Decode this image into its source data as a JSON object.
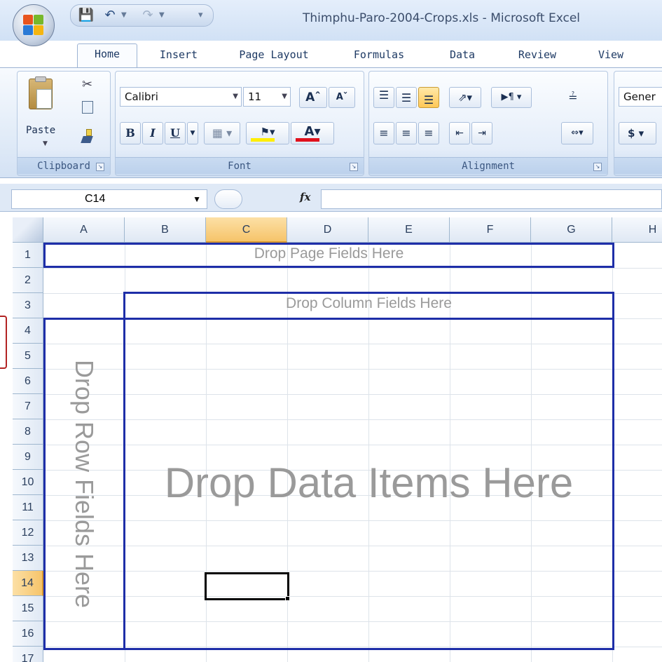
{
  "window": {
    "title": "Thimphu-Paro-2004-Crops.xls - Microsoft Excel"
  },
  "tabs": [
    {
      "label": "Home",
      "active": true
    },
    {
      "label": "Insert"
    },
    {
      "label": "Page Layout"
    },
    {
      "label": "Formulas"
    },
    {
      "label": "Data"
    },
    {
      "label": "Review"
    },
    {
      "label": "View"
    }
  ],
  "ribbon": {
    "clipboard": {
      "label": "Clipboard",
      "paste": "Paste"
    },
    "font": {
      "label": "Font",
      "name": "Calibri",
      "size": "11",
      "bold": "B",
      "italic": "I",
      "underline": "U"
    },
    "alignment": {
      "label": "Alignment"
    },
    "number": {
      "format": "Gener",
      "currency": "$"
    }
  },
  "formula_bar": {
    "name_box": "C14",
    "fx": "fx",
    "value": ""
  },
  "grid": {
    "columns": [
      "A",
      "B",
      "C",
      "D",
      "E",
      "F",
      "G",
      "H"
    ],
    "selected_column": "C",
    "rows": [
      "1",
      "2",
      "3",
      "4",
      "5",
      "6",
      "7",
      "8",
      "9",
      "10",
      "11",
      "12",
      "13",
      "14",
      "15",
      "16",
      "17"
    ],
    "selected_row": "14",
    "active_cell": "C14"
  },
  "pivot": {
    "page_fields": "Drop Page Fields Here",
    "column_fields": "Drop Column Fields Here",
    "row_fields": "Drop Row Fields Here",
    "data_items": "Drop Data Items Here"
  },
  "colors": {
    "accent": "#1e2ea8",
    "selection": "#f6c46a",
    "drop_text": "#9a9a9a"
  }
}
